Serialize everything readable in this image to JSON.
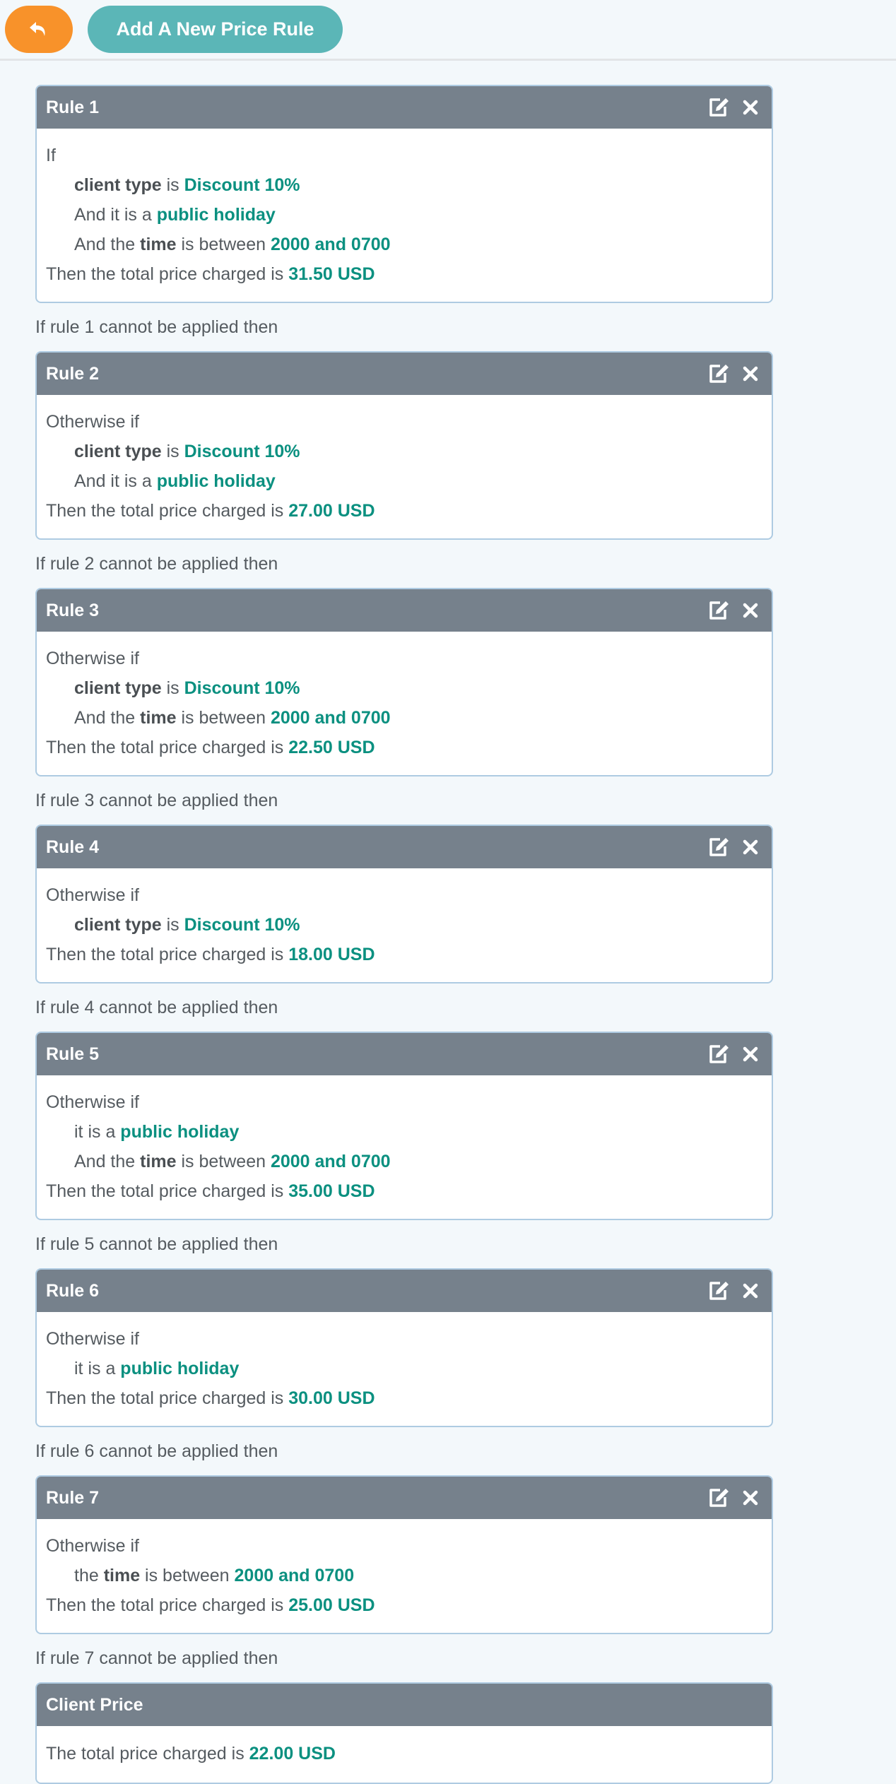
{
  "toolbar": {
    "back_icon": "reply-arrow-icon",
    "add_label": "Add A New Price Rule"
  },
  "colors": {
    "back_button": "#f8922a",
    "add_button": "#5bb6b7",
    "card_header": "#76818c",
    "highlight": "#0b9080"
  },
  "rules": [
    {
      "title": "Rule 1",
      "intro": "If",
      "conditions": [
        {
          "prefix": "",
          "key": "client type",
          "mid": " is ",
          "value": "Discount 10%"
        },
        {
          "prefix": "And it is a ",
          "key": "",
          "mid": "",
          "value": "public holiday"
        },
        {
          "prefix": "And the ",
          "key": "time",
          "mid": " is between ",
          "value": "2000 and 0700"
        }
      ],
      "result_prefix": "Then the total price charged is ",
      "price": "31.50 USD",
      "fallthrough": "If rule 1 cannot be applied then"
    },
    {
      "title": "Rule 2",
      "intro": "Otherwise if",
      "conditions": [
        {
          "prefix": "",
          "key": "client type",
          "mid": " is ",
          "value": "Discount 10%"
        },
        {
          "prefix": "And it is a ",
          "key": "",
          "mid": "",
          "value": "public holiday"
        }
      ],
      "result_prefix": "Then the total price charged is ",
      "price": "27.00 USD",
      "fallthrough": "If rule 2 cannot be applied then"
    },
    {
      "title": "Rule 3",
      "intro": "Otherwise if",
      "conditions": [
        {
          "prefix": "",
          "key": "client type",
          "mid": " is ",
          "value": "Discount 10%"
        },
        {
          "prefix": "And the ",
          "key": "time",
          "mid": " is between ",
          "value": "2000 and 0700"
        }
      ],
      "result_prefix": "Then the total price charged is ",
      "price": "22.50 USD",
      "fallthrough": "If rule 3 cannot be applied then"
    },
    {
      "title": "Rule 4",
      "intro": "Otherwise if",
      "conditions": [
        {
          "prefix": "",
          "key": "client type",
          "mid": " is ",
          "value": "Discount 10%"
        }
      ],
      "result_prefix": "Then the total price charged is ",
      "price": "18.00 USD",
      "fallthrough": "If rule 4 cannot be applied then"
    },
    {
      "title": "Rule 5",
      "intro": "Otherwise if",
      "conditions": [
        {
          "prefix": "it is a ",
          "key": "",
          "mid": "",
          "value": "public holiday"
        },
        {
          "prefix": "And the ",
          "key": "time",
          "mid": " is between ",
          "value": "2000 and 0700"
        }
      ],
      "result_prefix": "Then the total price charged is ",
      "price": "35.00 USD",
      "fallthrough": "If rule 5 cannot be applied then"
    },
    {
      "title": "Rule 6",
      "intro": "Otherwise if",
      "conditions": [
        {
          "prefix": "it is a ",
          "key": "",
          "mid": "",
          "value": "public holiday"
        }
      ],
      "result_prefix": "Then the total price charged is ",
      "price": "30.00 USD",
      "fallthrough": "If rule 6 cannot be applied then"
    },
    {
      "title": "Rule 7",
      "intro": "Otherwise if",
      "conditions": [
        {
          "prefix": "the ",
          "key": "time",
          "mid": " is between ",
          "value": "2000 and 0700"
        }
      ],
      "result_prefix": "Then the total price charged is ",
      "price": "25.00 USD",
      "fallthrough": "If rule 7 cannot be applied then"
    }
  ],
  "client_price": {
    "title": "Client Price",
    "text_prefix": "The total price charged is ",
    "price": "22.00 USD"
  }
}
